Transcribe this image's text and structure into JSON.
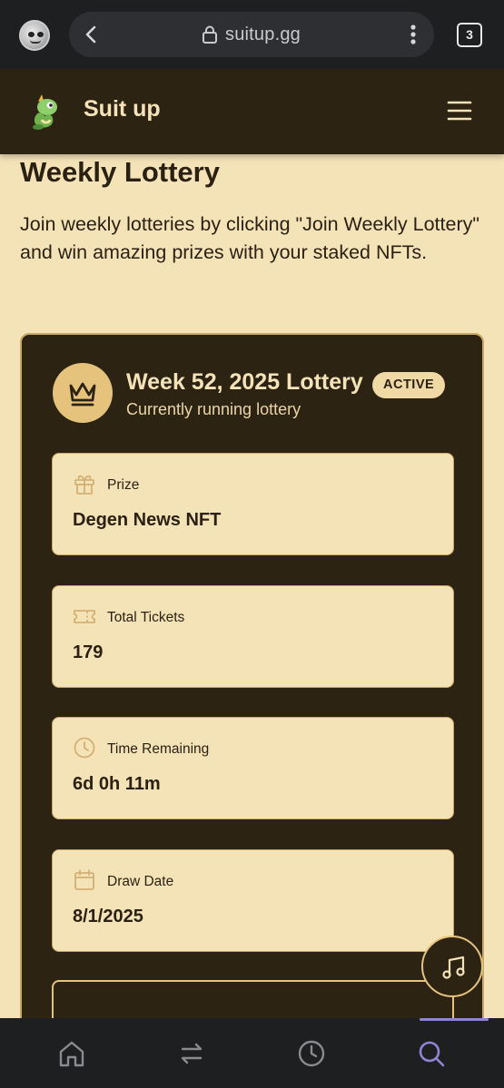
{
  "browser": {
    "url": "suitup.gg",
    "tab_count": "3"
  },
  "header": {
    "brand": "Suit up"
  },
  "page": {
    "title": "Weekly Lottery",
    "description": "Join weekly lotteries by clicking \"Join Weekly Lottery\" and win amazing prizes with your staked NFTs."
  },
  "lottery": {
    "title": "Week 52, 2025 Lottery",
    "status": "ACTIVE",
    "subtitle": "Currently running lottery",
    "stats": [
      {
        "icon": "gift-icon",
        "label": "Prize",
        "value": "Degen News NFT"
      },
      {
        "icon": "ticket-icon",
        "label": "Total Tickets",
        "value": "179"
      },
      {
        "icon": "clock-icon",
        "label": "Time Remaining",
        "value": "6d 0h 11m"
      },
      {
        "icon": "calendar-icon",
        "label": "Draw Date",
        "value": "8/1/2025"
      }
    ]
  },
  "bottom_nav": {
    "items": [
      "home-icon",
      "swap-icon",
      "history-icon",
      "search-icon"
    ],
    "active": "search-icon"
  },
  "colors": {
    "page_bg": "#f5e3b8",
    "dark": "#2d2313",
    "accent": "#e6c37c",
    "nav_active": "#8e85d6"
  }
}
